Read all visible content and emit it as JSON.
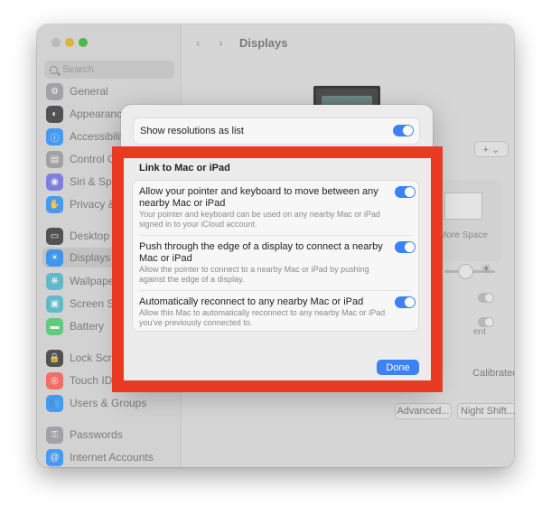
{
  "window": {
    "title": "Displays",
    "search_placeholder": "Search"
  },
  "sidebar": {
    "items": [
      {
        "label": "General",
        "icon": "gear-icon",
        "color": "#8e8e93"
      },
      {
        "label": "Appearance",
        "icon": "appearance-icon",
        "color": "#1c1c1e"
      },
      {
        "label": "Accessibility",
        "icon": "accessibility-icon",
        "color": "#0a84ff"
      },
      {
        "label": "Control Centre",
        "icon": "control-centre-icon",
        "color": "#8e8e93"
      },
      {
        "label": "Siri & Spotlight",
        "icon": "siri-icon",
        "color": "#5e5ce6"
      },
      {
        "label": "Privacy & Security",
        "icon": "hand-icon",
        "color": "#0a84ff"
      },
      {
        "label": "Desktop & Dock",
        "icon": "dock-icon",
        "color": "#1c1c1e"
      },
      {
        "label": "Displays",
        "icon": "display-icon",
        "color": "#0a84ff"
      },
      {
        "label": "Wallpaper",
        "icon": "wallpaper-icon",
        "color": "#30b0c7"
      },
      {
        "label": "Screen Saver",
        "icon": "screen-saver-icon",
        "color": "#30b0c7"
      },
      {
        "label": "Battery",
        "icon": "battery-icon",
        "color": "#34c759"
      },
      {
        "label": "Lock Screen",
        "icon": "lock-icon",
        "color": "#1c1c1e"
      },
      {
        "label": "Touch ID & Password",
        "icon": "fingerprint-icon",
        "color": "#ff453a"
      },
      {
        "label": "Users & Groups",
        "icon": "users-icon",
        "color": "#0a84ff"
      },
      {
        "label": "Passwords",
        "icon": "key-icon",
        "color": "#8e8e93"
      },
      {
        "label": "Internet Accounts",
        "icon": "at-icon",
        "color": "#0a84ff"
      }
    ]
  },
  "background": {
    "add_label": "+ ⌄",
    "more_space": "More Space",
    "calibrated": "Calibrated ◇",
    "advanced": "Advanced...",
    "night_shift": "Night Shift...",
    "help": "?",
    "ent_text": "ent"
  },
  "dialog": {
    "show_resolutions_label": "Show resolutions as list",
    "section_title": "Link to Mac or iPad",
    "options": [
      {
        "title": "Allow your pointer and keyboard to move between any nearby Mac or iPad",
        "desc": "Your pointer and keyboard can be used on any nearby Mac or iPad signed in to your iCloud account."
      },
      {
        "title": "Push through the edge of a display to connect a nearby Mac or iPad",
        "desc": "Allow the pointer to connect to a nearby Mac or iPad by pushing against the edge of a display."
      },
      {
        "title": "Automatically reconnect to any nearby Mac or iPad",
        "desc": "Allow this Mac to automatically reconnect to any nearby Mac or iPad you've previously connected to."
      }
    ],
    "done_label": "Done"
  },
  "colors": {
    "accent": "#3b82f6",
    "highlight_frame": "#eb3a24"
  }
}
